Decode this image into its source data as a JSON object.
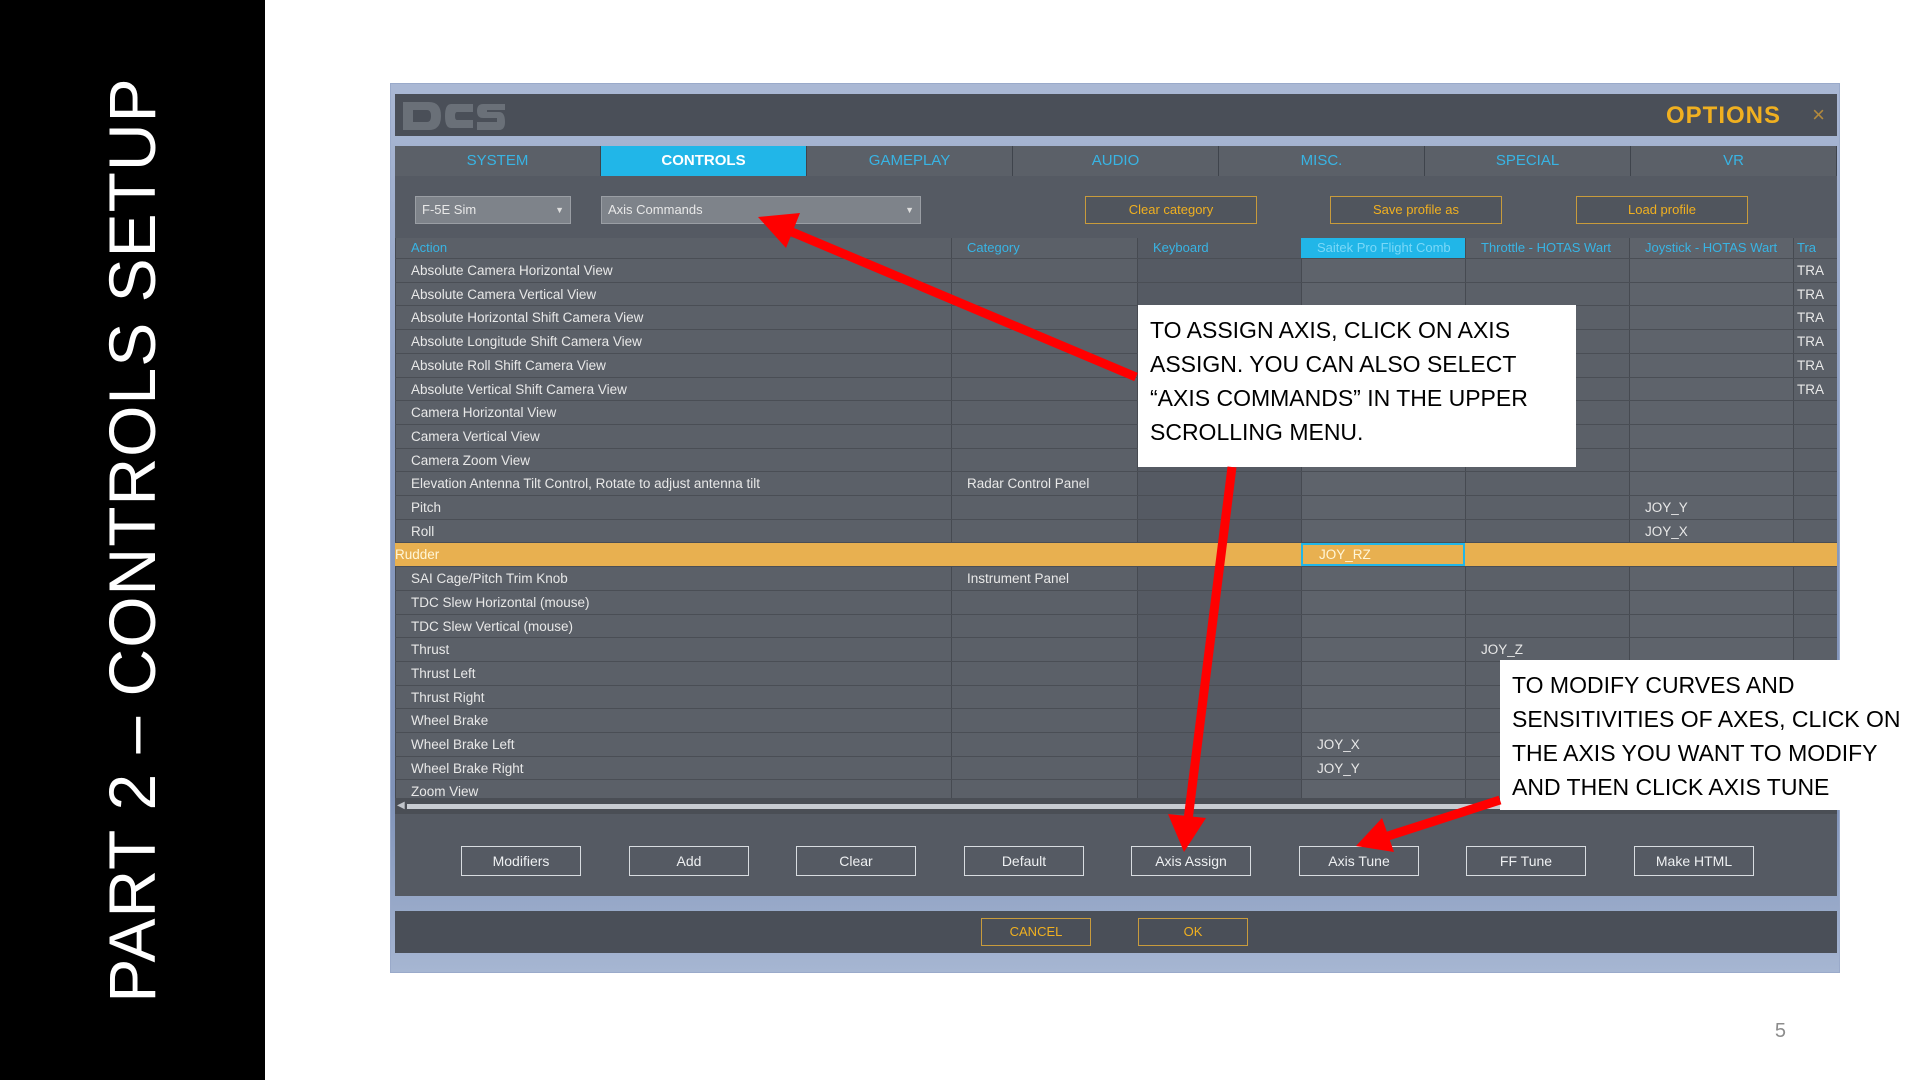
{
  "slide": {
    "title": "PART 2 – CONTROLS SETUP",
    "page_number": "5"
  },
  "window": {
    "logo": "DCS",
    "title": "OPTIONS",
    "close": "×",
    "tabs": [
      {
        "label": "SYSTEM",
        "active": false
      },
      {
        "label": "CONTROLS",
        "active": true
      },
      {
        "label": "GAMEPLAY",
        "active": false
      },
      {
        "label": "AUDIO",
        "active": false
      },
      {
        "label": "MISC.",
        "active": false
      },
      {
        "label": "SPECIAL",
        "active": false
      },
      {
        "label": "VR",
        "active": false
      }
    ],
    "aircraft_select": "F-5E Sim",
    "category_select": "Axis Commands",
    "clear_category": "Clear category",
    "save_profile": "Save profile as",
    "load_profile": "Load profile",
    "columns": [
      "Action",
      "Category",
      "Keyboard",
      "Saitek Pro Flight Comb",
      "Throttle - HOTAS Wart",
      "Joystick - HOTAS Wart",
      "Tra"
    ],
    "rows": [
      {
        "action": "Absolute Camera Horizontal View",
        "category": "",
        "keyboard": "",
        "saitek": "",
        "throttle": "",
        "joystick": "",
        "tra": "TRA"
      },
      {
        "action": "Absolute Camera Vertical View",
        "category": "",
        "keyboard": "",
        "saitek": "",
        "throttle": "",
        "joystick": "",
        "tra": "TRA"
      },
      {
        "action": "Absolute Horizontal Shift Camera View",
        "category": "",
        "keyboard": "",
        "saitek": "",
        "throttle": "",
        "joystick": "",
        "tra": "TRA"
      },
      {
        "action": "Absolute Longitude Shift Camera View",
        "category": "",
        "keyboard": "",
        "saitek": "",
        "throttle": "",
        "joystick": "",
        "tra": "TRA"
      },
      {
        "action": "Absolute Roll Shift Camera View",
        "category": "",
        "keyboard": "",
        "saitek": "",
        "throttle": "",
        "joystick": "",
        "tra": "TRA"
      },
      {
        "action": "Absolute Vertical Shift Camera View",
        "category": "",
        "keyboard": "",
        "saitek": "",
        "throttle": "",
        "joystick": "",
        "tra": "TRA"
      },
      {
        "action": "Camera Horizontal View",
        "category": "",
        "keyboard": "",
        "saitek": "",
        "throttle": "",
        "joystick": "",
        "tra": ""
      },
      {
        "action": "Camera Vertical View",
        "category": "",
        "keyboard": "",
        "saitek": "",
        "throttle": "",
        "joystick": "",
        "tra": ""
      },
      {
        "action": "Camera Zoom View",
        "category": "",
        "keyboard": "",
        "saitek": "",
        "throttle": "",
        "joystick": "",
        "tra": ""
      },
      {
        "action": "Elevation Antenna Tilt Control, Rotate to adjust antenna tilt",
        "category": "Radar Control Panel",
        "keyboard": "",
        "saitek": "",
        "throttle": "",
        "joystick": "",
        "tra": ""
      },
      {
        "action": "Pitch",
        "category": "",
        "keyboard": "",
        "saitek": "",
        "throttle": "",
        "joystick": "JOY_Y",
        "tra": ""
      },
      {
        "action": "Roll",
        "category": "",
        "keyboard": "",
        "saitek": "",
        "throttle": "",
        "joystick": "JOY_X",
        "tra": ""
      },
      {
        "action": "Rudder",
        "category": "",
        "keyboard": "",
        "saitek": "JOY_RZ",
        "throttle": "",
        "joystick": "",
        "tra": "",
        "selected": true
      },
      {
        "action": "SAI Cage/Pitch Trim Knob",
        "category": "Instrument Panel",
        "keyboard": "",
        "saitek": "",
        "throttle": "",
        "joystick": "",
        "tra": ""
      },
      {
        "action": "TDC Slew Horizontal (mouse)",
        "category": "",
        "keyboard": "",
        "saitek": "",
        "throttle": "",
        "joystick": "",
        "tra": ""
      },
      {
        "action": "TDC Slew Vertical (mouse)",
        "category": "",
        "keyboard": "",
        "saitek": "",
        "throttle": "",
        "joystick": "",
        "tra": ""
      },
      {
        "action": "Thrust",
        "category": "",
        "keyboard": "",
        "saitek": "",
        "throttle": "JOY_Z",
        "joystick": "",
        "tra": ""
      },
      {
        "action": "Thrust Left",
        "category": "",
        "keyboard": "",
        "saitek": "",
        "throttle": "",
        "joystick": "",
        "tra": ""
      },
      {
        "action": "Thrust Right",
        "category": "",
        "keyboard": "",
        "saitek": "",
        "throttle": "",
        "joystick": "",
        "tra": ""
      },
      {
        "action": "Wheel Brake",
        "category": "",
        "keyboard": "",
        "saitek": "",
        "throttle": "",
        "joystick": "",
        "tra": ""
      },
      {
        "action": "Wheel Brake Left",
        "category": "",
        "keyboard": "",
        "saitek": "JOY_X",
        "throttle": "",
        "joystick": "",
        "tra": ""
      },
      {
        "action": "Wheel Brake Right",
        "category": "",
        "keyboard": "",
        "saitek": "JOY_Y",
        "throttle": "",
        "joystick": "",
        "tra": ""
      },
      {
        "action": "Zoom View",
        "category": "",
        "keyboard": "",
        "saitek": "",
        "throttle": "",
        "joystick": "",
        "tra": ""
      }
    ],
    "bottom_buttons": [
      "Modifiers",
      "Add",
      "Clear",
      "Default",
      "Axis Assign",
      "Axis Tune",
      "FF Tune",
      "Make HTML"
    ],
    "cancel": "CANCEL",
    "ok": "OK"
  },
  "callouts": {
    "assign": "TO ASSIGN AXIS, CLICK ON AXIS\nASSIGN. YOU CAN ALSO SELECT\n“AXIS COMMANDS” IN THE UPPER\nSCROLLING MENU.",
    "tune": "TO MODIFY CURVES AND\nSENSITIVITIES OF AXES, CLICK ON\nTHE AXIS YOU WANT TO MODIFY\nAND THEN CLICK AXIS TUNE"
  },
  "colors": {
    "accent": "#21b6e8",
    "selected_row": "#e8b050",
    "gold": "#f0b020",
    "arrow": "#ff0000"
  }
}
